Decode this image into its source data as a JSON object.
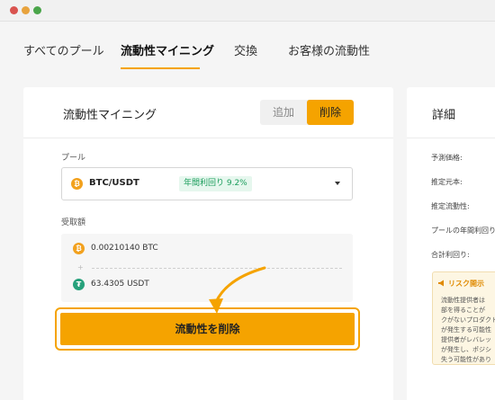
{
  "nav": {
    "tabs": [
      {
        "label": "すべてのプール",
        "active": false
      },
      {
        "label": "流動性マイニング",
        "active": true
      },
      {
        "label": "交換",
        "active": false
      },
      {
        "label": "お客様の流動性",
        "active": false
      }
    ]
  },
  "panel": {
    "title": "流動性マイニング",
    "segment": {
      "add_label": "追加",
      "remove_label": "削除",
      "selected": "削除"
    },
    "pool_label": "プール",
    "pool": {
      "coin_icon": "bitcoin-icon",
      "coin_glyph": "₿",
      "name": "BTC/USDT",
      "apr": "年間利回り 9.2%"
    },
    "receive_label": "受取額",
    "receive": [
      {
        "icon": "bitcoin-icon",
        "glyph": "₿",
        "amount": "0.00210140 BTC"
      },
      {
        "icon": "tether-icon",
        "glyph": "₮",
        "amount": "63.4305 USDT"
      }
    ],
    "plus_symbol": "+",
    "remove_button": "流動性を削除"
  },
  "details": {
    "title": "詳細",
    "rows": [
      "予測価格:",
      "推定元本:",
      "推定流動性:",
      "プールの年間利回り",
      "合計利回り:"
    ],
    "risk": {
      "title": "リスク開示",
      "lines": [
        "流動性提供者は",
        "部を得ることが",
        "クがないプロダクト",
        "が発生する可能性",
        "提供者がレバレッ",
        "が発生し、ポジシ",
        "失う可能性があり"
      ]
    }
  },
  "colors": {
    "accent": "#f5a300",
    "apr_green": "#1a9c5b",
    "btc": "#f2a11e",
    "usdt": "#26a17b"
  }
}
